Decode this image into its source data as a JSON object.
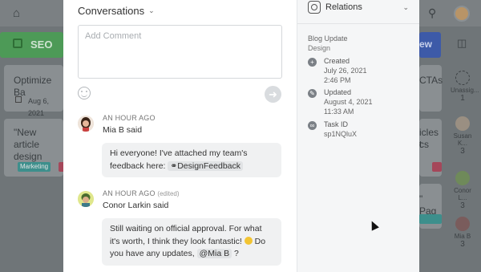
{
  "background": {
    "columns": [
      {
        "title": "SEO"
      },
      {
        "title": "ew"
      }
    ],
    "cards": [
      {
        "title": "Optimize Ba",
        "date": "Aug 6, 2021"
      },
      {
        "title": "\"New article design",
        "tags": [
          "Marketing"
        ]
      }
    ],
    "right_cards": [
      {
        "title": "CTAs"
      },
      {
        "title": "icles t",
        "line2": "cs"
      },
      {
        "title": "\" Pag"
      }
    ],
    "sidebar_people": [
      {
        "name": "Unassig...",
        "count": "1"
      },
      {
        "name": "Susan K...",
        "count": "3"
      },
      {
        "name": "Conor L...",
        "count": "3"
      },
      {
        "name": "Mia B",
        "count": "3"
      }
    ],
    "colors": {
      "seo": "#4d9a57",
      "new": "#3d5aa8",
      "tag_marketing": "#3d8f8c",
      "tag_red": "#a5475a"
    }
  },
  "conversations": {
    "title": "Conversations",
    "comment_placeholder": "Add Comment",
    "messages": [
      {
        "time": "AN HOUR AGO",
        "edited": "",
        "author": "Mia B",
        "action": "said",
        "text_before": "Hi everyone! I've attached my team's feedback here:",
        "link": "DesignFeedback",
        "text_after": ""
      },
      {
        "time": "AN HOUR AGO",
        "edited": "(edited)",
        "author": "Conor Larkin",
        "action": "said",
        "text_before": "Still waiting on official approval. For what it's worth, I think they look fantastic!",
        "text_middle": "Do you have any updates,",
        "mention": "@Mia B",
        "text_after": "?"
      }
    ]
  },
  "relations": {
    "title": "Relations",
    "task_name": "Blog Update",
    "task_type": "Design",
    "items": [
      {
        "icon": "plus-circle-icon",
        "label": "Created",
        "value1": "July 26, 2021",
        "value2": "2:46 PM"
      },
      {
        "icon": "pencil-icon",
        "label": "Updated",
        "value1": "August 4, 2021",
        "value2": "11:33 AM"
      },
      {
        "icon": "link-icon",
        "label": "Task ID",
        "value1": "sp1NQluX",
        "value2": ""
      }
    ]
  }
}
